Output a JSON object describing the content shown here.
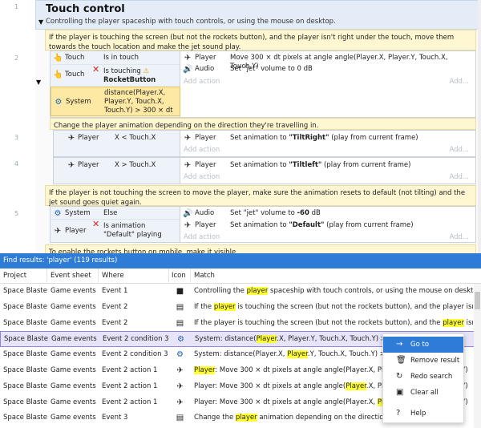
{
  "sheet": {
    "group": {
      "title": "Touch control",
      "description": "Controlling the player spaceship with touch controls, or using the mouse on desktop."
    },
    "add_action": "Add action",
    "add": "Add...",
    "comments": [
      "If the player is touching the screen (but not the rockets button), and the player isn't right under the touch, move them towards the touch location and make the jet sound play.",
      "Change the player animation depending on the direction they're travelling in.",
      "If the player is not touching the screen to move the player, make sure the animation resets to default (not tilting) and the jet sound goes quiet again.",
      "To enable the rockets button on mobile, make it visible"
    ],
    "events": [
      {
        "number": "2",
        "conditions": [
          {
            "icon": "touch-icon",
            "object": "Touch",
            "text": "Is in touch"
          },
          {
            "icon": "touch-icon",
            "object": "Touch",
            "text_a": "Is touching",
            "text_b": "RocketButton"
          },
          {
            "icon": "system-icon",
            "object": "System",
            "text": "distance(Player.X, Player.Y, Touch.X, Touch.Y) > 300 × dt"
          }
        ],
        "actions": [
          {
            "icon": "ship-icon",
            "object": "Player",
            "text": "Move 300 × dt pixels at angle angle(Player.X, Player.Y, Touch.X, Touch.Y)"
          },
          {
            "icon": "audio-icon",
            "object": "Audio",
            "text": "Set \"jet\" volume to 0 dB"
          }
        ]
      },
      {
        "number": "3",
        "conditions": [
          {
            "icon": "ship-icon",
            "object": "Player",
            "text": "X < Touch.X"
          }
        ],
        "actions": [
          {
            "icon": "ship-icon",
            "object": "Player",
            "text_a": "Set animation to ",
            "text_b": "\"TiltRight\"",
            "text_c": " (play from current frame)"
          }
        ]
      },
      {
        "number": "4",
        "conditions": [
          {
            "icon": "ship-icon",
            "object": "Player",
            "text": "X > Touch.X"
          }
        ],
        "actions": [
          {
            "icon": "ship-icon",
            "object": "Player",
            "text_a": "Set animation to ",
            "text_b": "\"Tiltleft\"",
            "text_c": " (play from current frame)"
          }
        ]
      },
      {
        "number": "5",
        "conditions": [
          {
            "icon": "system-icon",
            "object": "System",
            "text": "Else"
          },
          {
            "icon": "ship-icon",
            "object": "Player",
            "text": "Is animation \"Default\" playing"
          }
        ],
        "actions": [
          {
            "icon": "audio-icon",
            "object": "Audio",
            "text_a": "Set \"jet\" volume to ",
            "text_b": "-60",
            "text_c": " dB"
          },
          {
            "icon": "ship-icon",
            "object": "Player",
            "text_a": "Set animation to ",
            "text_b": "\"Default\"",
            "text_c": " (play from current frame)"
          }
        ]
      }
    ]
  },
  "results": {
    "title": "Find results: 'player' (119 results)",
    "columns": [
      "Project",
      "Event sheet",
      "Where",
      "Icon",
      "Match"
    ],
    "rows": [
      {
        "project": "Space Blaster",
        "sheet": "Game events",
        "where": "Event 1",
        "icon": "folder-icon",
        "pre": "Controlling the ",
        "hl": "player",
        "post": " spaceship with touch controls, or using the mouse on desktop."
      },
      {
        "project": "Space Blaster",
        "sheet": "Game events",
        "where": "Event 2",
        "icon": "comment-icon",
        "pre": "If the ",
        "hl": "player",
        "post": " is touching the screen (but not the rockets button), and the player isn't right ..."
      },
      {
        "project": "Space Blaster",
        "sheet": "Game events",
        "where": "Event 2",
        "icon": "comment-icon",
        "pre": "If the player is touching the screen (but not the rockets button), and the ",
        "hl": "player",
        "post": " isn't right ..."
      },
      {
        "project": "Space Blaster",
        "sheet": "Game events",
        "where": "Event 2 condition 3",
        "icon": "system-icon",
        "pre": "System: distance(",
        "hl": "Player",
        "post": ".X, Player.Y, Touch.X, Touch.Y) > 300 × dt"
      },
      {
        "project": "Space Blaster",
        "sheet": "Game events",
        "where": "Event 2 condition 3",
        "icon": "system-icon",
        "pre": "System: distance(Player.X, ",
        "hl": "Player",
        "post": ".Y, Touch.X, Touch.Y) > 300 × dt"
      },
      {
        "project": "Space Blaster",
        "sheet": "Game events",
        "where": "Event 2 action 1",
        "icon": "ship-icon",
        "pre": "",
        "hl": "Player",
        "post": ": Move 300 × dt pixels at angle angle(Player.X, Player.Y, Touch.X, Touch.Y)"
      },
      {
        "project": "Space Blaster",
        "sheet": "Game events",
        "where": "Event 2 action 1",
        "icon": "ship-icon",
        "pre": "Player: Move 300 × dt pixels at angle angle(",
        "hl": "Player",
        "post": ".X, Player.Y, Touch.X, Touch.Y)"
      },
      {
        "project": "Space Blaster",
        "sheet": "Game events",
        "where": "Event 2 action 1",
        "icon": "ship-icon",
        "pre": "Player: Move 300 × dt pixels at angle angle(Player.X, ",
        "hl": "Player",
        "post": ".Y, Touch.X, Touch.Y)"
      },
      {
        "project": "Space Blaster",
        "sheet": "Game events",
        "where": "Event 3",
        "icon": "comment-icon",
        "pre": "Change the ",
        "hl": "player",
        "post": " animation depending on the direction they're travelling in."
      }
    ],
    "selected_row": 3
  },
  "context_menu": {
    "items": [
      {
        "icon": "arrow-right-icon",
        "label": "Go to"
      },
      {
        "icon": "trash-icon",
        "label": "Remove result"
      },
      {
        "icon": "refresh-icon",
        "label": "Redo search"
      },
      {
        "icon": "clear-icon",
        "label": "Clear all"
      },
      {
        "icon": "help-icon",
        "label": "Help"
      }
    ]
  },
  "colors": {
    "accent": "#2f7cd7",
    "highlight": "#ffff33",
    "comment_bg": "#fff7d1",
    "selected_row": "#e7e4f9"
  }
}
